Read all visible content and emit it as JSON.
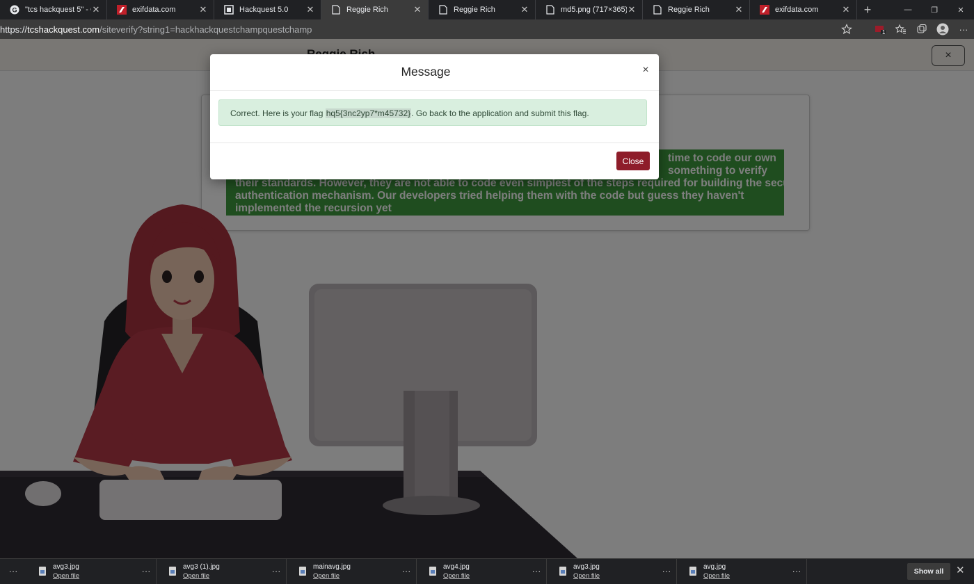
{
  "browser": {
    "tabs": [
      {
        "title": "\"tcs hackquest 5\" - Goo",
        "icon": "google-icon",
        "active": false
      },
      {
        "title": "exifdata.com",
        "icon": "exifdata-favicon",
        "active": false
      },
      {
        "title": "Hackquest 5.0",
        "icon": "hackquest-favicon",
        "active": false
      },
      {
        "title": "Reggie Rich",
        "icon": "page-icon",
        "active": true
      },
      {
        "title": "Reggie Rich",
        "icon": "page-icon",
        "active": false
      },
      {
        "title": "md5.png (717×365)",
        "icon": "page-icon",
        "active": false
      },
      {
        "title": "Reggie Rich",
        "icon": "page-icon",
        "active": false
      },
      {
        "title": "exifdata.com",
        "icon": "exifdata-favicon",
        "active": false
      }
    ],
    "new_tab": "+",
    "window_controls": [
      "—",
      "❐",
      "✕"
    ],
    "address": {
      "prefix": "https://",
      "host": "tcshackquest.com",
      "path": "/siteverify?string1=hackhackquestchampquestchamp"
    },
    "toolbar": {
      "extension_badge": "1",
      "more": "···"
    }
  },
  "page": {
    "header_name": "Reggie Rich",
    "header_close": "×",
    "story_lines": [
      "time to code our own",
      "something to verify",
      "their standards. However, they are not able to code even simplest of the steps required for building the secure",
      "authentication mechanism. Our developers tried helping them with the code but guess they haven't",
      "implemented the recursion yet"
    ]
  },
  "modal": {
    "title": "Message",
    "close_x": "×",
    "alert_before": "Correct. Here is your flag ",
    "flag": "hq5{3nc2yp7*m45732}",
    "alert_after": ". Go back to the application and submit this flag.",
    "close_button": "Close"
  },
  "downloads": {
    "more": "···",
    "items": [
      {
        "name": "avg3.jpg",
        "action": "Open file"
      },
      {
        "name": "avg3 (1).jpg",
        "action": "Open file"
      },
      {
        "name": "mainavg.jpg",
        "action": "Open file"
      },
      {
        "name": "avg4.jpg",
        "action": "Open file"
      },
      {
        "name": "avg3.jpg",
        "action": "Open file"
      },
      {
        "name": "avg.jpg",
        "action": "Open file"
      }
    ],
    "show_all": "Show all",
    "close": "✕"
  },
  "colors": {
    "accent_button": "#8e1d2a",
    "story_background": "#3f9b3f",
    "alert_background": "#d9efdf"
  }
}
